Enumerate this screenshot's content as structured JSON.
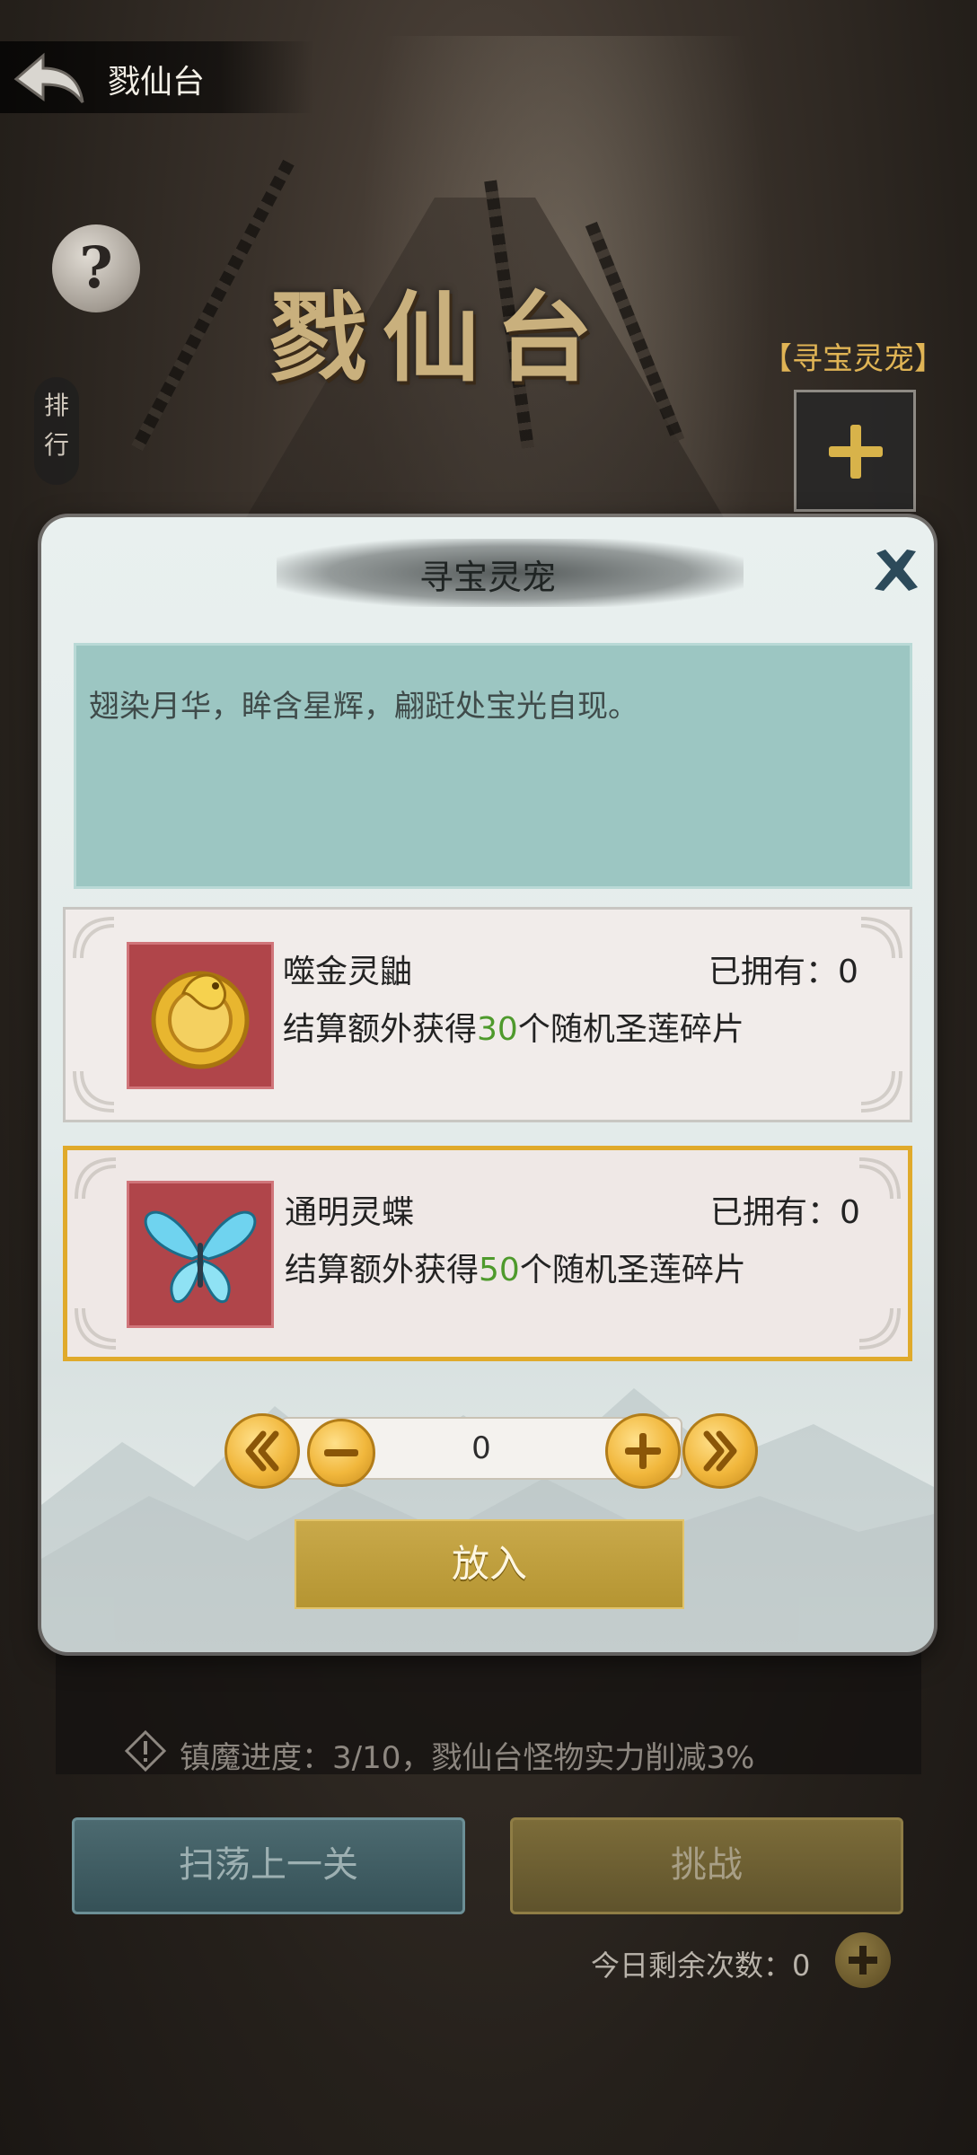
{
  "header": {
    "page_title": "戮仙台",
    "big_title": "戮仙台",
    "help_label": "?",
    "rank_label": "排行",
    "pet_slot_label": "【寻宝灵宠】"
  },
  "dialog": {
    "title": "寻宝灵宠",
    "description": "翅染月华，眸含星辉，翩跹处宝光自现。",
    "pets": [
      {
        "name": "噬金灵鼬",
        "owned_label": "已拥有：",
        "owned_count": "0",
        "effect_prefix": "结算额外获得",
        "effect_amount": "30",
        "effect_suffix": "个随机圣莲碎片",
        "selected": false
      },
      {
        "name": "通明灵蝶",
        "owned_label": "已拥有：",
        "owned_count": "0",
        "effect_prefix": "结算额外获得",
        "effect_amount": "50",
        "effect_suffix": "个随机圣莲碎片",
        "selected": true
      }
    ],
    "quantity": "0",
    "put_button": "放入"
  },
  "footer": {
    "progress_text": "镇魔进度：3/10，戮仙台怪物实力削减3%",
    "sweep_button": "扫荡上一关",
    "challenge_button": "挑战",
    "remaining_label": "今日剩余次数：",
    "remaining_count": "0"
  },
  "colors": {
    "accent_gold": "#e0aa2b",
    "highlight_green": "#4e9a2c",
    "desc_bg": "#9cc6c2",
    "pet_icon_bg": "#b0454a"
  }
}
